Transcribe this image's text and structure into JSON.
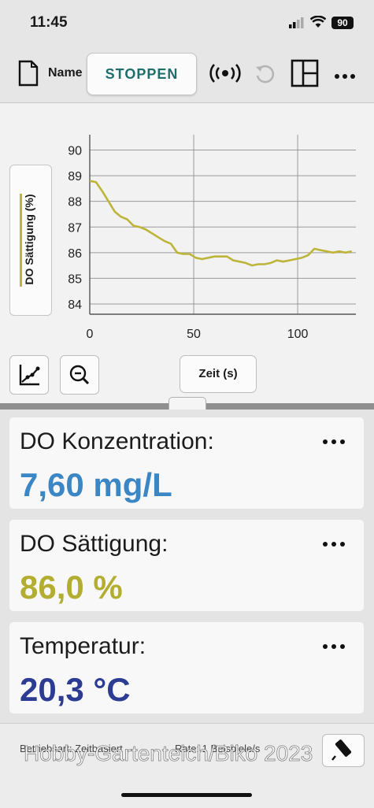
{
  "status_bar": {
    "time": "11:45",
    "battery": "90"
  },
  "toolbar": {
    "name_label": "Name",
    "stop_label": "STOPPEN"
  },
  "graph": {
    "y_axis_label": "DO Sättigung (%)",
    "x_axis_label": "Zeit (s)"
  },
  "chart_data": {
    "type": "line",
    "xlabel": "Zeit (s)",
    "ylabel": "DO Sättigung (%)",
    "xlim": [
      0,
      128
    ],
    "ylim": [
      83.6,
      90.6
    ],
    "x_ticks": [
      0,
      50,
      100
    ],
    "y_ticks": [
      84,
      85,
      86,
      87,
      88,
      89,
      90
    ],
    "grid": true,
    "color": "#bcb53a",
    "series": [
      {
        "x": [
          0,
          3,
          6,
          9,
          12,
          15,
          18,
          21,
          24,
          27,
          30,
          33,
          36,
          39,
          42,
          45,
          48,
          51,
          54,
          57,
          60,
          63,
          66,
          69,
          72,
          75,
          78,
          81,
          84,
          87,
          90,
          93,
          96,
          99,
          102,
          105,
          108,
          111,
          114,
          117,
          120,
          123,
          126
        ],
        "y": [
          88.8,
          88.75,
          88.4,
          88.0,
          87.6,
          87.4,
          87.3,
          87.05,
          87.0,
          86.9,
          86.75,
          86.6,
          86.45,
          86.35,
          86.0,
          85.95,
          85.95,
          85.8,
          85.75,
          85.8,
          85.85,
          85.85,
          85.85,
          85.7,
          85.65,
          85.6,
          85.5,
          85.55,
          85.55,
          85.6,
          85.7,
          85.65,
          85.7,
          85.75,
          85.8,
          85.9,
          86.15,
          86.1,
          86.05,
          86.0,
          86.05,
          86.0,
          86.05
        ]
      }
    ]
  },
  "panels": [
    {
      "label": "DO Konzentration:",
      "value": "7,60 mg/L",
      "color": "#3b86c5"
    },
    {
      "label": "DO Sättigung:",
      "value": "86,0 %",
      "color": "#b3ad32"
    },
    {
      "label": "Temperatur:",
      "value": "20,3 °C",
      "color": "#2c3c92"
    }
  ],
  "footer": {
    "mode": "Betriebsart: Zeitbasiert",
    "rate": "Rate: 1 Beispiele/s",
    "watermark": "Hobby-Gartenteich/Biko 2023"
  }
}
